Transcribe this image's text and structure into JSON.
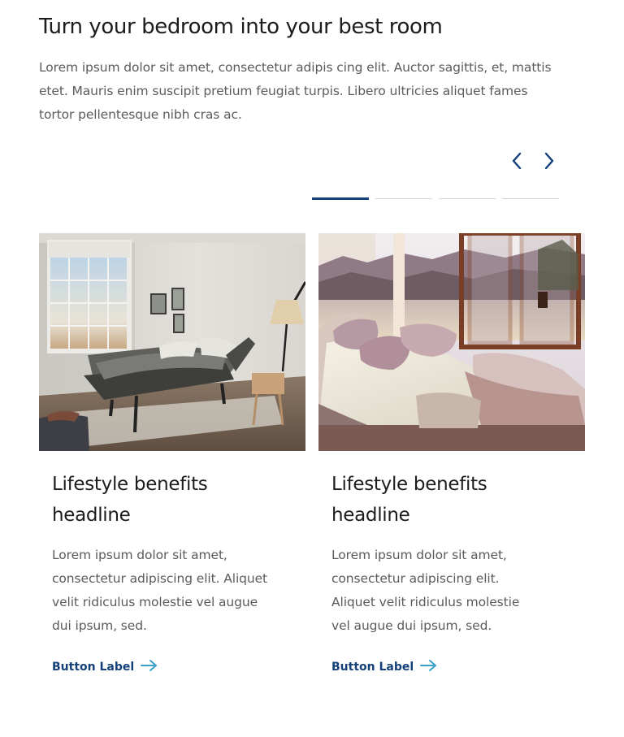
{
  "hero": {
    "title": "Turn your bedroom into your best room",
    "body": "Lorem ipsum dolor sit amet, consectetur adipis cing elit. Auctor sagittis, et, mattis etet. Mauris enim suscipit pretium feugiat turpis. Libero ultricies aliquet fames tortor pellentesque nibh cras ac."
  },
  "carousel": {
    "prev_icon": "chevron-left-icon",
    "next_icon": "chevron-right-icon",
    "indicator_count": 4,
    "active_index": 0
  },
  "cards": [
    {
      "image_alt": "Bedroom with adjustable bed near a large window",
      "title": "Lifestyle benefits headline",
      "text": "Lorem ipsum dolor sit amet, consectetur adipiscing elit. Aliquet velit ridiculus molestie vel augue dui ipsum, sed.",
      "link_label": "Button Label",
      "link_icon": "arrow-right-icon"
    },
    {
      "image_alt": "Adjustable bed with pillows facing a mountain view",
      "title": "Lifestyle benefits headline",
      "text": "Lorem ipsum dolor sit amet, consectetur adipiscing elit. Aliquet velit ridiculus molestie vel augue dui ipsum, sed.",
      "link_label": "Button Label",
      "link_icon": "arrow-right-icon"
    }
  ],
  "colors": {
    "accent": "#13407a",
    "arrow_accent": "#3aa0c8",
    "heading": "#1c1c1c",
    "body_text": "#5b5b5b",
    "indicator_inactive": "#d4d4d4"
  }
}
